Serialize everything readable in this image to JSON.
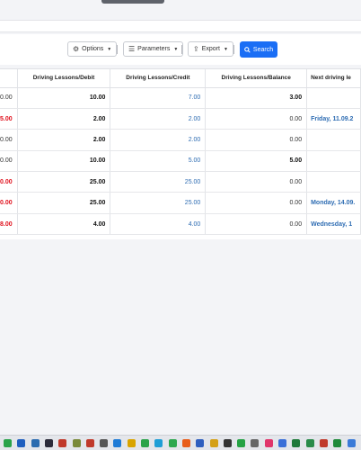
{
  "toolbar": {
    "options_label": "Options",
    "parameters_label": "Parameters",
    "export_label": "Export",
    "search_label": "Search"
  },
  "table": {
    "headers": [
      "",
      "Driving Lessons/Debit",
      "Driving Lessons/Credit",
      "Driving Lessons/Balance",
      "Next driving le"
    ],
    "rows": [
      {
        "c0": "0.00",
        "c0_style": "norm",
        "debit": "10.00",
        "credit": "7.00",
        "balance": "3.00",
        "balance_style": "bold",
        "next": ""
      },
      {
        "c0": "5.00",
        "c0_style": "red",
        "debit": "2.00",
        "credit": "2.00",
        "balance": "0.00",
        "balance_style": "norm",
        "next": "Friday, 11.09.2"
      },
      {
        "c0": "0.00",
        "c0_style": "norm",
        "debit": "2.00",
        "credit": "2.00",
        "balance": "0.00",
        "balance_style": "norm",
        "next": ""
      },
      {
        "c0": "0.00",
        "c0_style": "norm",
        "debit": "10.00",
        "credit": "5.00",
        "balance": "5.00",
        "balance_style": "bold",
        "next": ""
      },
      {
        "c0": "0.00",
        "c0_style": "red",
        "debit": "25.00",
        "credit": "25.00",
        "balance": "0.00",
        "balance_style": "norm",
        "next": ""
      },
      {
        "c0": "0.00",
        "c0_style": "red",
        "debit": "25.00",
        "credit": "25.00",
        "balance": "0.00",
        "balance_style": "norm",
        "next": "Monday, 14.09."
      },
      {
        "c0": "8.00",
        "c0_style": "red",
        "debit": "4.00",
        "credit": "4.00",
        "balance": "0.00",
        "balance_style": "norm",
        "next": "Wednesday, 1"
      }
    ]
  },
  "colors": {
    "accent": "#1a6ef5",
    "link_blue": "#2f6db3",
    "negative_red": "#e0101c"
  },
  "taskbar": {
    "icons": [
      {
        "name": "app-icon-1",
        "color": "#2aa34a"
      },
      {
        "name": "app-icon-2",
        "color": "#1f5fbf"
      },
      {
        "name": "app-icon-3",
        "color": "#2b6cb0"
      },
      {
        "name": "app-icon-4",
        "color": "#2b2b3a"
      },
      {
        "name": "app-icon-5",
        "color": "#c0392b"
      },
      {
        "name": "app-icon-6",
        "color": "#7a8a3a"
      },
      {
        "name": "app-icon-7",
        "color": "#c0392b"
      },
      {
        "name": "app-icon-8",
        "color": "#555"
      },
      {
        "name": "app-icon-9",
        "color": "#1f7bd6"
      },
      {
        "name": "app-icon-10",
        "color": "#d9a400"
      },
      {
        "name": "app-icon-11",
        "color": "#2aa34a"
      },
      {
        "name": "app-icon-12",
        "color": "#1f9ed6"
      },
      {
        "name": "app-icon-13",
        "color": "#2ea84f"
      },
      {
        "name": "app-icon-14",
        "color": "#e85d1a"
      },
      {
        "name": "app-icon-15",
        "color": "#2f5fbf"
      },
      {
        "name": "app-icon-16",
        "color": "#d4a017"
      },
      {
        "name": "app-icon-17",
        "color": "#333"
      },
      {
        "name": "app-icon-18",
        "color": "#25a244"
      },
      {
        "name": "app-icon-19",
        "color": "#666"
      },
      {
        "name": "app-icon-20",
        "color": "#e0356b"
      },
      {
        "name": "app-icon-21",
        "color": "#3a6fd8"
      },
      {
        "name": "app-icon-22",
        "color": "#1f7a3a"
      },
      {
        "name": "app-icon-23",
        "color": "#2a8b4a"
      },
      {
        "name": "app-icon-24",
        "color": "#c0392b"
      },
      {
        "name": "app-icon-25",
        "color": "#1f8a3a"
      },
      {
        "name": "app-icon-26",
        "color": "#3b7bd8"
      }
    ]
  }
}
